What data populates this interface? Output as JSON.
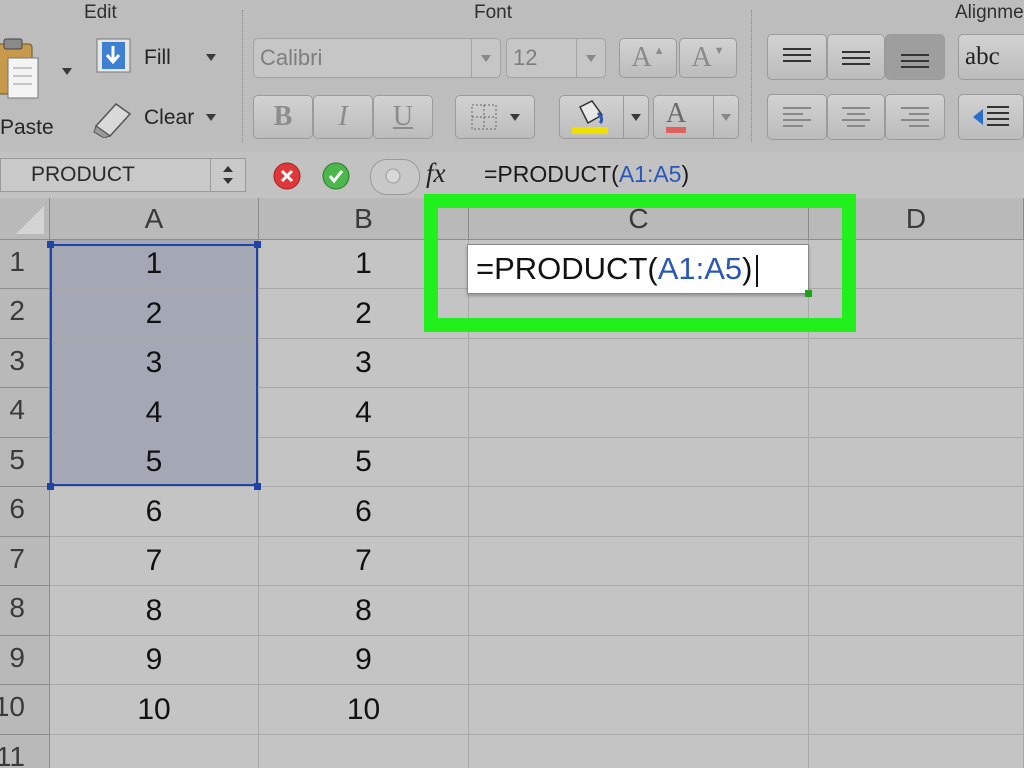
{
  "ribbon": {
    "edit_label": "Edit",
    "font_label": "Font",
    "alignment_label": "Alignme",
    "paste_label": "Paste",
    "fill_label": "Fill",
    "clear_label": "Clear",
    "font_name": "Calibri",
    "font_size": "12",
    "bold": "B",
    "italic": "I",
    "underline": "U",
    "grow_font": "A",
    "shrink_font": "A",
    "font_color_glyph": "A",
    "wrap_label": "abc",
    "highlight_color": "#f0e000",
    "font_color": "#e03030"
  },
  "formula_bar": {
    "name_box": "PRODUCT",
    "fx": "fx",
    "formula_prefix": "=PRODUCT(",
    "formula_ref": "A1:A5",
    "formula_suffix": ")"
  },
  "grid": {
    "columns": [
      "A",
      "B",
      "C",
      "D"
    ],
    "rows": [
      "1",
      "2",
      "3",
      "4",
      "5",
      "6",
      "7",
      "8",
      "9",
      "10",
      "11"
    ],
    "col_a": [
      "1",
      "2",
      "3",
      "4",
      "5",
      "6",
      "7",
      "8",
      "9",
      "10"
    ],
    "col_b": [
      "1",
      "2",
      "3",
      "4",
      "5",
      "6",
      "7",
      "8",
      "9",
      "10"
    ]
  },
  "editor": {
    "prefix": "=PRODUCT(",
    "ref": "A1:A5",
    "suffix": ")"
  },
  "colors": {
    "highlight_box": "#22f01c",
    "selection_border": "#2043a8",
    "reference_text": "#2a57b8"
  }
}
